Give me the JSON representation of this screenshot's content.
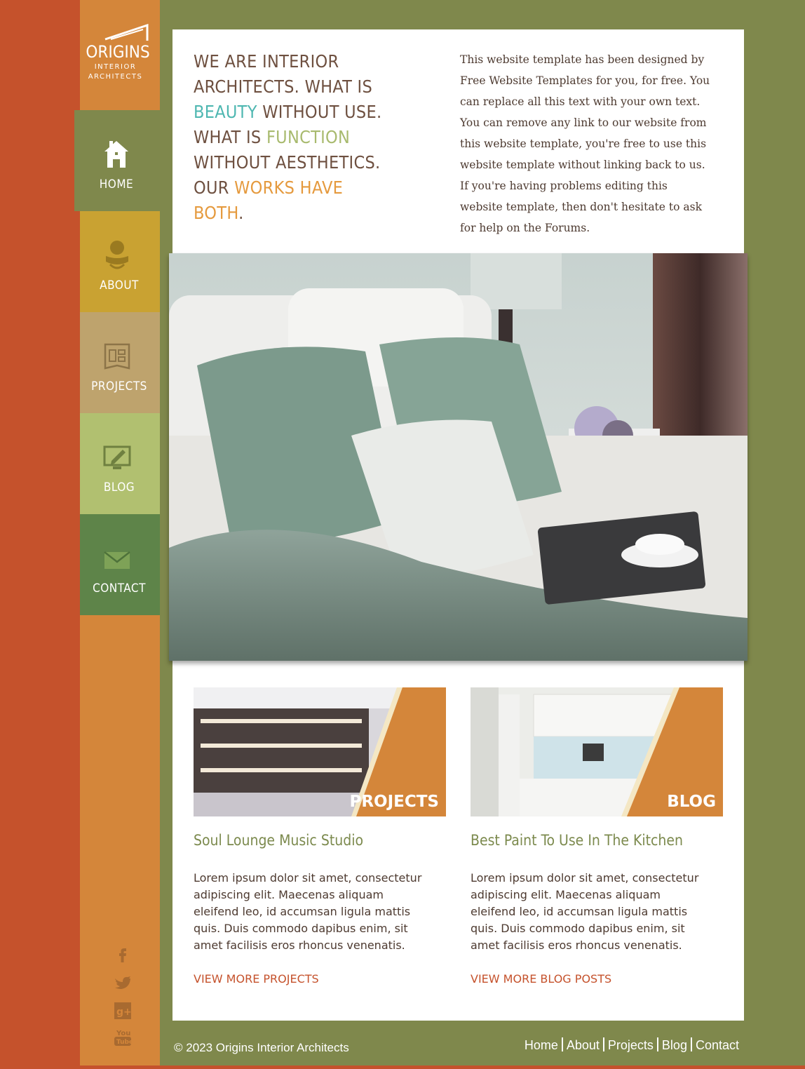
{
  "brand": {
    "name": "ORIGINS",
    "line1": "INTERIOR",
    "line2": "ARCHITECTS"
  },
  "nav": [
    {
      "label": "HOME",
      "icon": "house-icon",
      "bg": "#7f884c",
      "selected": true
    },
    {
      "label": "ABOUT",
      "icon": "person-icon",
      "bg": "#c9a232"
    },
    {
      "label": "PROJECTS",
      "icon": "blueprint-icon",
      "bg": "#bea36d"
    },
    {
      "label": "BLOG",
      "icon": "monitor-pencil-icon",
      "bg": "#b1c070"
    },
    {
      "label": "CONTACT",
      "icon": "envelope-icon",
      "bg": "#5e8449"
    }
  ],
  "social": [
    "facebook-icon",
    "twitter-icon",
    "google-plus-icon",
    "youtube-icon"
  ],
  "headline": {
    "p1": "WE ARE INTERIOR ARCHITECTS. WHAT IS ",
    "beauty": "BEAUTY",
    "p2": " WITHOUT USE. WHAT IS ",
    "function": "FUNCTION",
    "p3": " WITHOUT AESTHETICS. OUR ",
    "works": "WORKS HAVE BOTH",
    "p4": "."
  },
  "intro": "This website template has been designed by Free Website Templates for you, for free. You can replace all this text with your own text. You can remove any link to our website from this website template, you're free to use this website template without linking back to us. If you're having problems editing this website template, then don't hesitate to ask for help on the Forums.",
  "cards": [
    {
      "badge": "PROJECTS",
      "title": "Soul Lounge Music Studio",
      "text": "Lorem ipsum dolor sit amet, consectetur adipiscing elit. Maecenas aliquam eleifend leo, id accumsan ligula mattis quis. Duis commodo dapibus enim, sit amet facilisis eros rhoncus venenatis.",
      "link": "VIEW MORE PROJECTS"
    },
    {
      "badge": "BLOG",
      "title": "Best Paint To Use In The Kitchen",
      "text": "Lorem ipsum dolor sit amet, consectetur adipiscing elit. Maecenas aliquam eleifend leo, id accumsan ligula mattis quis. Duis commodo dapibus enim, sit amet facilisis eros rhoncus venenatis.",
      "link": "VIEW MORE BLOG POSTS"
    }
  ],
  "footer": {
    "copyright": "© 2023 Origins Interior Architects",
    "links": [
      "Home",
      "About",
      "Projects",
      "Blog",
      "Contact"
    ]
  },
  "colors": {
    "rust": "#c5522c",
    "orange": "#d4863a",
    "olive": "#7f884c"
  }
}
